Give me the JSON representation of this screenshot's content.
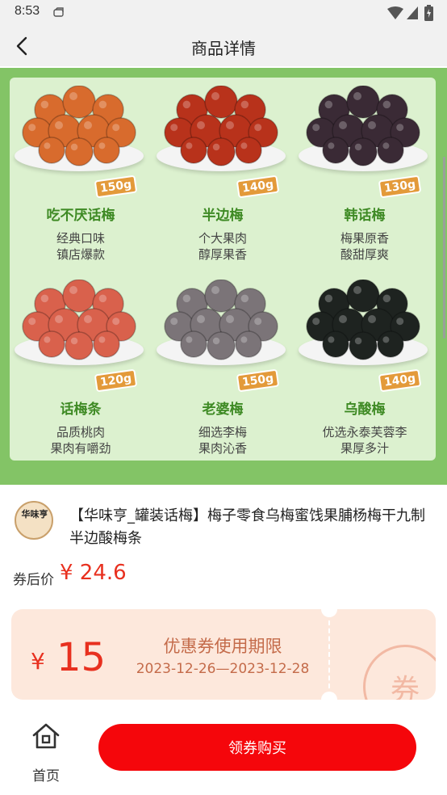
{
  "status_bar": {
    "time": "8:53",
    "icons": [
      "notification-icon",
      "wifi-icon",
      "signal-icon",
      "battery-icon"
    ]
  },
  "nav": {
    "title": "商品详情",
    "back_icon": "chevron-left-icon"
  },
  "banner": {
    "slide_count": 4,
    "active_slide": 1,
    "products": [
      {
        "name": "吃不厌话梅",
        "weight": "150g",
        "desc1": "经典口味",
        "desc2": "镇店爆款",
        "fruit_color": "#d86b2d"
      },
      {
        "name": "半边梅",
        "weight": "140g",
        "desc1": "个大果肉",
        "desc2": "醇厚果香",
        "fruit_color": "#b8321b"
      },
      {
        "name": "韩话梅",
        "weight": "130g",
        "desc1": "梅果原香",
        "desc2": "酸甜厚爽",
        "fruit_color": "#3a2a35"
      },
      {
        "name": "话梅条",
        "weight": "120g",
        "desc1": "品质桃肉",
        "desc2": "果肉有嚼劲",
        "fruit_color": "#d9614c"
      },
      {
        "name": "老婆梅",
        "weight": "150g",
        "desc1": "细选李梅",
        "desc2": "果肉沁香",
        "fruit_color": "#7b7478"
      },
      {
        "name": "乌酸梅",
        "weight": "140g",
        "desc1": "优选永泰芙蓉李",
        "desc2": "果厚多汁",
        "fruit_color": "#1e2320"
      }
    ]
  },
  "shop": {
    "logo_text": "华味亨"
  },
  "product": {
    "title": "【华味亨_罐装话梅】梅子零食乌梅蜜饯果脯杨梅干九制半边酸梅条",
    "price_label": "券后价",
    "price": "¥ 24.6"
  },
  "coupon": {
    "currency": "¥",
    "amount": "15",
    "title": "优惠券使用期限",
    "dates": "2023-12-26—2023-12-28",
    "stamp_text": "券"
  },
  "bottom_bar": {
    "home_label": "首页",
    "home_icon": "home-icon",
    "buy_label": "领券购买"
  },
  "colors": {
    "accent_red": "#f5060b",
    "price_red": "#e8301f",
    "banner_green": "#83c466",
    "product_name_green": "#3e8a24",
    "coupon_bg": "#fde8dc"
  }
}
